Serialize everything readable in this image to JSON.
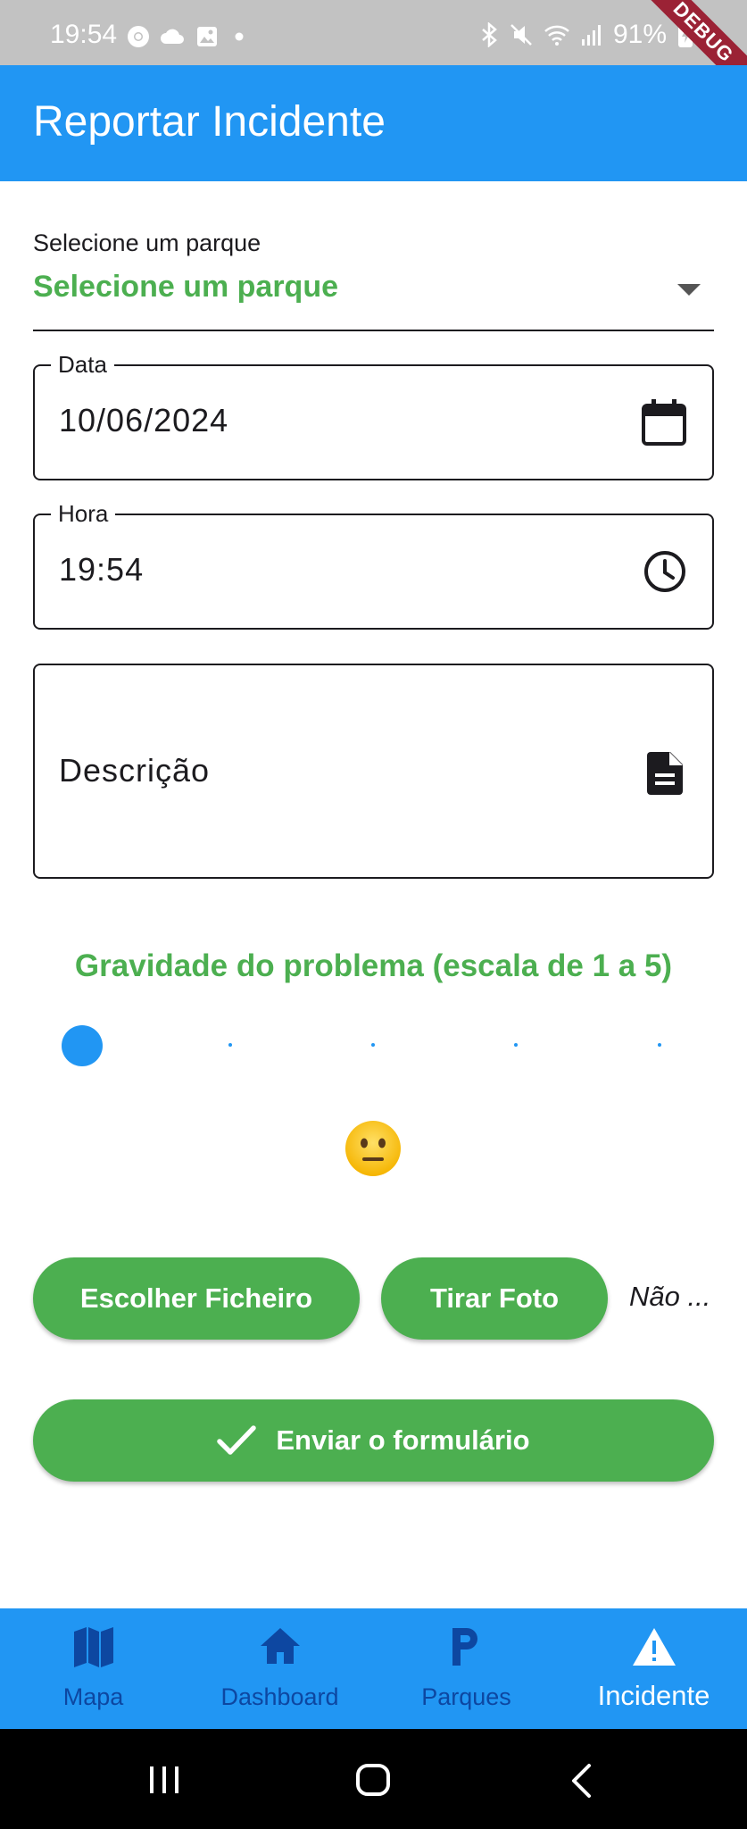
{
  "status_bar": {
    "time": "19:54",
    "battery": "91%",
    "left_icons": [
      "chrome-icon",
      "cloud-icon",
      "gallery-icon",
      "dot-icon"
    ],
    "right_icons": [
      "bluetooth-icon",
      "mute-icon",
      "wifi-icon",
      "signal-icon",
      "battery-charging-icon"
    ],
    "debug_banner": "DEBUG"
  },
  "app_bar": {
    "title": "Reportar Incidente",
    "color": "#2196f3"
  },
  "form": {
    "park_dropdown": {
      "label": "Selecione um parque",
      "value": "Selecione um parque"
    },
    "date_field": {
      "label": "Data",
      "value": "10/06/2024",
      "icon": "calendar-icon"
    },
    "time_field": {
      "label": "Hora",
      "value": "19:54",
      "icon": "clock-icon"
    },
    "description_field": {
      "placeholder": "Descrição",
      "icon": "document-icon"
    },
    "severity": {
      "title": "Gravidade do problema (escala de 1 a 5)",
      "min": 1,
      "max": 5,
      "value": 1,
      "emoji": "neutral-face-icon"
    },
    "choose_file_button": "Escolher Ficheiro",
    "take_photo_button": "Tirar Foto",
    "file_status": "Não ...",
    "submit_button": "Enviar o formulário"
  },
  "bottom_nav": {
    "items": [
      {
        "label": "Mapa",
        "icon": "map-icon",
        "active": false
      },
      {
        "label": "Dashboard",
        "icon": "home-icon",
        "active": false
      },
      {
        "label": "Parques",
        "icon": "parking-icon",
        "active": false
      },
      {
        "label": "Incidente",
        "icon": "warning-icon",
        "active": true
      }
    ]
  },
  "colors": {
    "primary": "#2196f3",
    "accent_green": "#4caf50",
    "inactive_nav": "#0d47a1"
  }
}
